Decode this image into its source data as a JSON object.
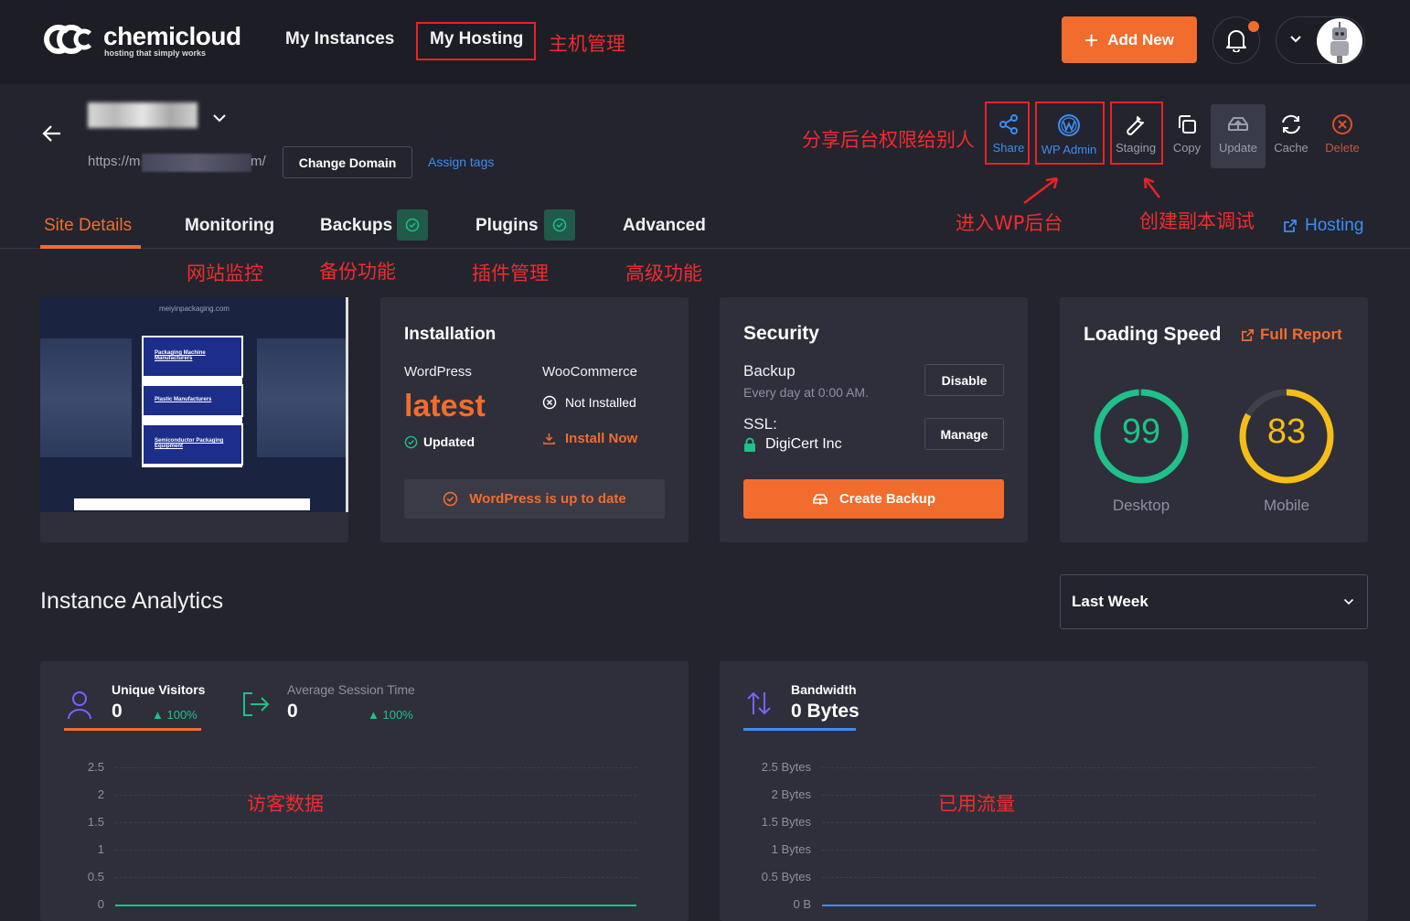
{
  "brand": {
    "name": "chemicloud",
    "tagline": "hosting that simply works"
  },
  "nav": {
    "instances": "My Instances",
    "hosting": "My Hosting"
  },
  "header": {
    "add_new": "Add New"
  },
  "site": {
    "url_prefix": "https://m",
    "url_suffix": "m/",
    "change_domain": "Change Domain",
    "assign_tags": "Assign tags"
  },
  "tools": [
    {
      "label": "Share",
      "icon": "share-icon"
    },
    {
      "label": "WP Admin",
      "icon": "wordpress-icon"
    },
    {
      "label": "Staging",
      "icon": "wrench-icon"
    },
    {
      "label": "Copy",
      "icon": "copy-icon"
    },
    {
      "label": "Update",
      "icon": "cloud-upload-icon"
    },
    {
      "label": "Cache",
      "icon": "refresh-icon"
    },
    {
      "label": "Delete",
      "icon": "close-circle-icon"
    }
  ],
  "tabs": {
    "site_details": "Site Details",
    "monitoring": "Monitoring",
    "backups": "Backups",
    "plugins": "Plugins",
    "advanced": "Advanced",
    "hosting": "Hosting"
  },
  "annotations": {
    "hosting_mgmt": "主机管理",
    "share": "分享后台权限给别人",
    "wp_admin": "进入WP后台",
    "staging": "创建副本调试",
    "monitoring": "网站监控",
    "backups": "备份功能",
    "plugins": "插件管理",
    "advanced": "高级功能",
    "visitors": "访客数据",
    "bandwidth": "已用流量"
  },
  "preview": {
    "domain": "meiyinpackaging.com",
    "links": [
      "Packaging Machine Manufacturers",
      "Plastic Manufacturers",
      "Semiconductor Packaging Equipment"
    ]
  },
  "installation": {
    "title": "Installation",
    "wordpress_label": "WordPress",
    "wordpress_version": "latest",
    "wordpress_status": "Updated",
    "woo_label": "WooCommerce",
    "woo_status": "Not Installed",
    "woo_action": "Install Now",
    "up_to_date": "WordPress is up to date"
  },
  "security": {
    "title": "Security",
    "backup_label": "Backup",
    "backup_schedule": "Every day at 0:00 AM.",
    "disable": "Disable",
    "ssl_label": "SSL:",
    "ssl_provider": "DigiCert Inc",
    "manage": "Manage",
    "create_backup": "Create Backup"
  },
  "speed": {
    "title": "Loading Speed",
    "full_report": "Full Report",
    "desktop_score": "99",
    "desktop_label": "Desktop",
    "mobile_score": "83",
    "mobile_label": "Mobile",
    "desktop_value": 99,
    "mobile_value": 83,
    "desktop_color": "#1fc189",
    "mobile_color": "#f5bd19"
  },
  "analytics": {
    "title": "Instance Analytics",
    "period": "Last Week",
    "visitors": {
      "label": "Unique Visitors",
      "value": "0",
      "change": "100%"
    },
    "session": {
      "label": "Average Session Time",
      "value": "0",
      "change": "100%"
    },
    "bandwidth": {
      "label": "Bandwidth",
      "value": "0 Bytes"
    },
    "visitors_ticks": [
      "2.5",
      "2",
      "1.5",
      "1",
      "0.5",
      "0"
    ],
    "bandwidth_ticks": [
      "2.5 Bytes",
      "2 Bytes",
      "1.5 Bytes",
      "1 Bytes",
      "0.5 Bytes",
      "0 B"
    ]
  },
  "colors": {
    "accent": "#f26c2d",
    "link": "#3d8cf5",
    "green": "#1fc189"
  }
}
